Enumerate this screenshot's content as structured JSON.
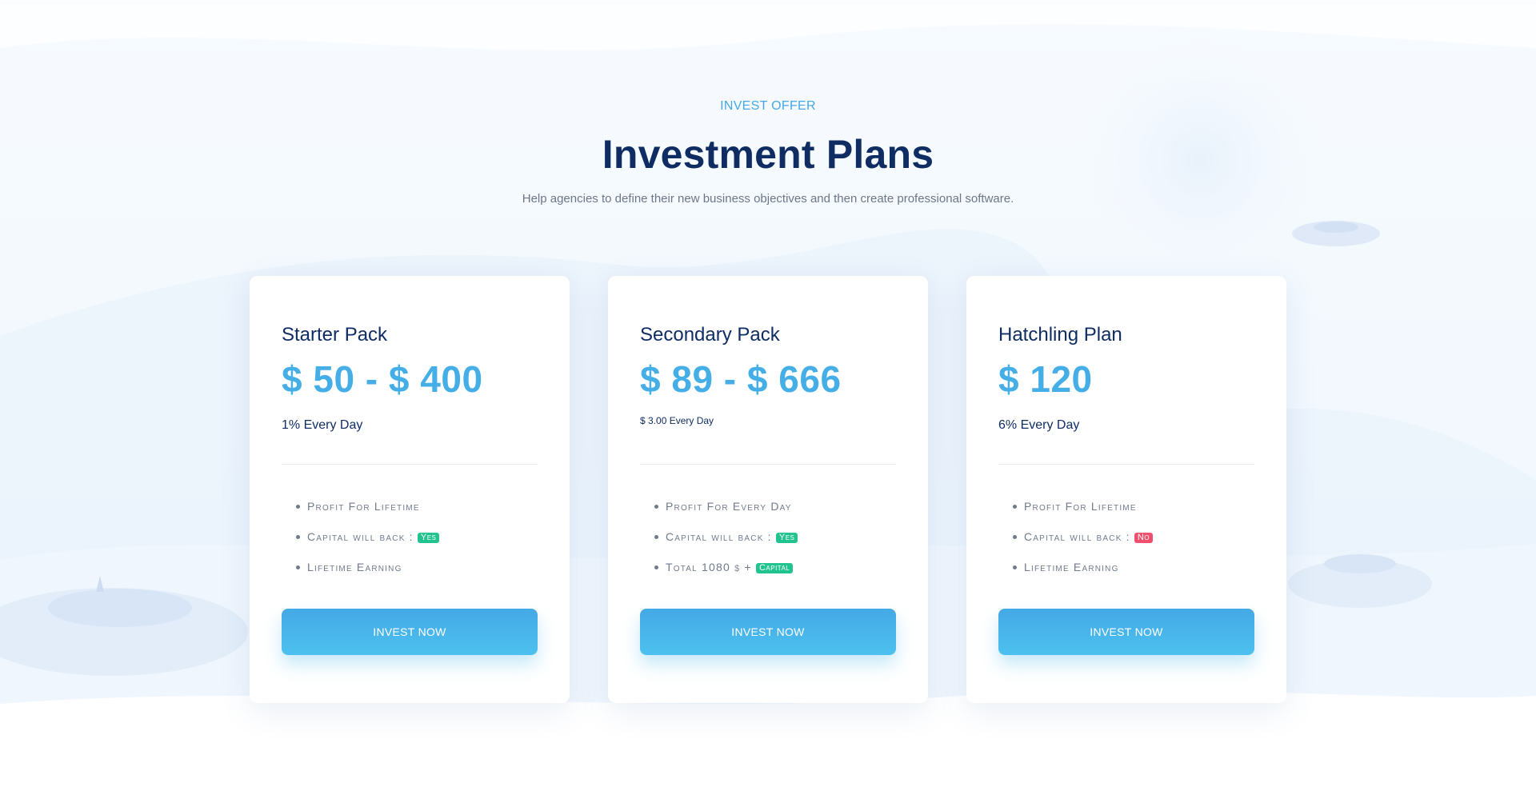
{
  "section": {
    "eyebrow": "INVEST OFFER",
    "title": "Investment Plans",
    "subtitle": "Help agencies to define their new business objectives and then create professional software."
  },
  "colors": {
    "accent": "#45aee7",
    "title": "#0f2d63",
    "badge_yes": "#22c38e",
    "badge_no": "#f0506e"
  },
  "plans": [
    {
      "name": "Starter Pack",
      "price": "$ 50 - $ 400",
      "rate": "1% Every Day",
      "features": [
        {
          "text": "Profit For Lifetime"
        },
        {
          "text": "Capital will back :",
          "badge": "Yes"
        },
        {
          "text": "Lifetime Earning"
        }
      ],
      "button": "INVEST NOW"
    },
    {
      "name": "Secondary Pack",
      "price": "$ 89 - $ 666",
      "rate": "$ 3.00 Every Day",
      "features": [
        {
          "text": "Profit For Every Day"
        },
        {
          "text": "Capital will back :",
          "badge": "Yes"
        },
        {
          "text": "Total 1080",
          "symbol": "$",
          "plus": "+",
          "badge": "Capital"
        }
      ],
      "button": "INVEST NOW"
    },
    {
      "name": "Hatchling Plan",
      "price": "$ 120",
      "rate": "6% Every Day",
      "features": [
        {
          "text": "Profit For Lifetime"
        },
        {
          "text": "Capital will back :",
          "badge": "No"
        },
        {
          "text": "Lifetime Earning"
        }
      ],
      "button": "INVEST NOW"
    }
  ]
}
